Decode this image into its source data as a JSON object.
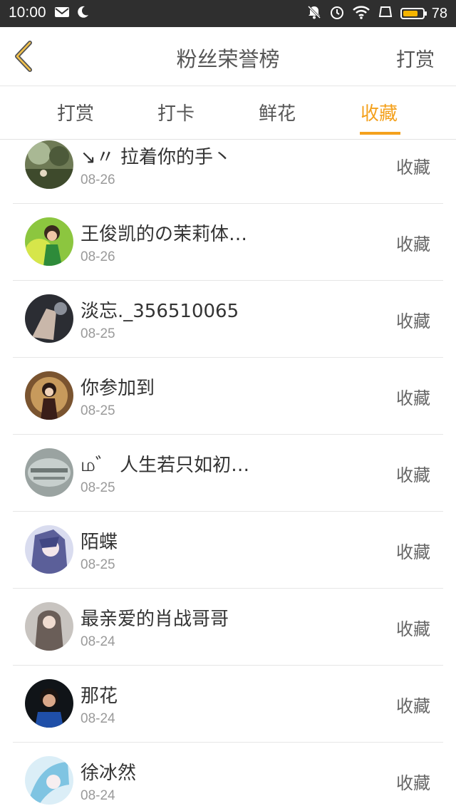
{
  "status_bar": {
    "time": "10:00",
    "battery": "78",
    "battery_level": 0.78
  },
  "header": {
    "title": "粉丝荣誉榜",
    "right_action": "打赏",
    "back_icon": "chevron-left-icon"
  },
  "tabs": [
    {
      "label": "打赏",
      "active": false
    },
    {
      "label": "打卡",
      "active": false
    },
    {
      "label": "鲜花",
      "active": false
    },
    {
      "label": "收藏",
      "active": true
    }
  ],
  "colors": {
    "accent": "#f4a11d",
    "text": "#333333",
    "muted": "#9a9a9a"
  },
  "list": [
    {
      "name": "↘〃 拉着你的手丶",
      "date": "08-26",
      "action": "收藏"
    },
    {
      "name": "王俊凯的の茉莉体…",
      "date": "08-26",
      "action": "收藏"
    },
    {
      "name": "淡忘._356510065",
      "date": "08-25",
      "action": "收藏"
    },
    {
      "name": "你参加到",
      "date": "08-25",
      "action": "收藏"
    },
    {
      "name": "ம゛ 人生若只如初…",
      "date": "08-25",
      "action": "收藏"
    },
    {
      "name": "陌蝶",
      "date": "08-25",
      "action": "收藏"
    },
    {
      "name": "最亲爱的肖战哥哥",
      "date": "08-24",
      "action": "收藏"
    },
    {
      "name": "那花",
      "date": "08-24",
      "action": "收藏"
    },
    {
      "name": "徐冰然",
      "date": "08-24",
      "action": "收藏"
    }
  ]
}
